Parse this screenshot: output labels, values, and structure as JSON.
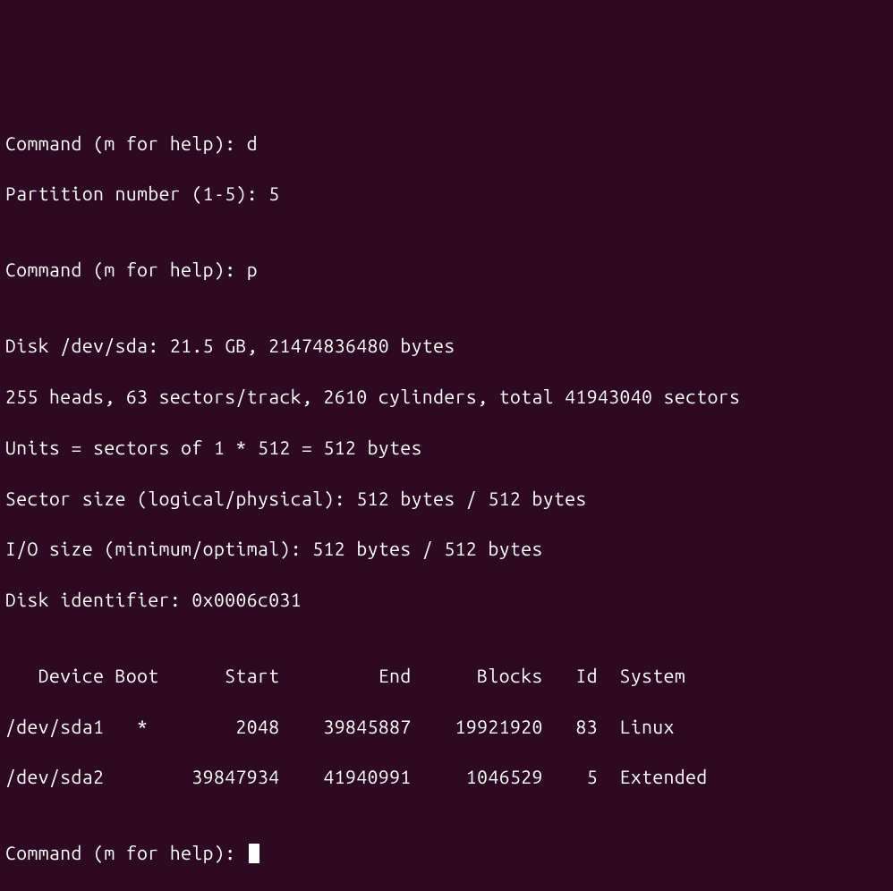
{
  "lines": {
    "l1": "Command (m for help): d",
    "l2": "Partition number (1-5): 5",
    "l3": "",
    "l4": "Command (m for help): p",
    "l5": "",
    "l6": "Disk /dev/sda: 21.5 GB, 21474836480 bytes",
    "l7": "255 heads, 63 sectors/track, 2610 cylinders, total 41943040 sectors",
    "l8": "Units = sectors of 1 * 512 = 512 bytes",
    "l9": "Sector size (logical/physical): 512 bytes / 512 bytes",
    "l10": "I/O size (minimum/optimal): 512 bytes / 512 bytes",
    "l11": "Disk identifier: 0x0006c031",
    "l12": "",
    "l13": "   Device Boot      Start         End      Blocks   Id  System",
    "l14": "/dev/sda1   *        2048    39845887    19921920   83  Linux",
    "l15": "/dev/sda2        39847934    41940991     1046529    5  Extended",
    "l16": "",
    "l17": "Command (m for help): "
  },
  "disk_info": {
    "device": "/dev/sda",
    "size_gb": "21.5 GB",
    "size_bytes": "21474836480",
    "heads": 255,
    "sectors_per_track": 63,
    "cylinders": 2610,
    "total_sectors": 41943040,
    "unit_size": 512,
    "sector_size_logical": "512 bytes",
    "sector_size_physical": "512 bytes",
    "io_min": "512 bytes",
    "io_optimal": "512 bytes",
    "identifier": "0x0006c031"
  },
  "partitions": [
    {
      "device": "/dev/sda1",
      "boot": "*",
      "start": 2048,
      "end": 39845887,
      "blocks": 19921920,
      "id": "83",
      "system": "Linux"
    },
    {
      "device": "/dev/sda2",
      "boot": "",
      "start": 39847934,
      "end": 41940991,
      "blocks": 1046529,
      "id": "5",
      "system": "Extended"
    }
  ],
  "commands": {
    "delete_cmd": "d",
    "partition_num": "5",
    "print_cmd": "p"
  }
}
